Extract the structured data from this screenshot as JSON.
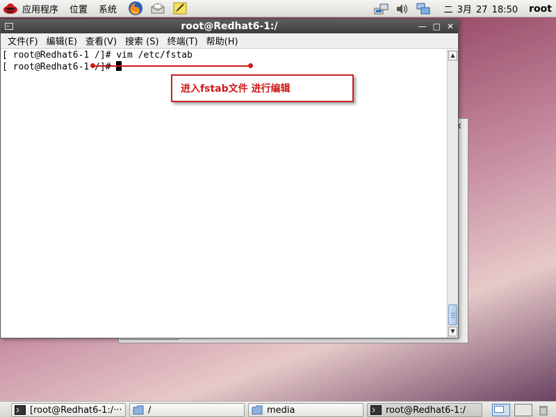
{
  "top_panel": {
    "menus": [
      {
        "name": "applications",
        "label": "应用程序"
      },
      {
        "name": "places",
        "label": "位置"
      },
      {
        "name": "system",
        "label": "系统"
      }
    ],
    "launchers": [
      "firefox-icon",
      "mail-icon",
      "notes-icon"
    ],
    "tray_icons": [
      "network-icon",
      "volume-icon",
      "display-icon"
    ],
    "clock": "二 3月 27 18:50",
    "user": "root"
  },
  "terminal": {
    "title": "root@Redhat6-1:/",
    "menu": [
      {
        "name": "file",
        "label": "文件(F)"
      },
      {
        "name": "edit",
        "label": "编辑(E)"
      },
      {
        "name": "view",
        "label": "查看(V)"
      },
      {
        "name": "search",
        "label": "搜索 (S)"
      },
      {
        "name": "terminal",
        "label": "终端(T)"
      },
      {
        "name": "help",
        "label": "帮助(H)"
      }
    ],
    "lines": [
      "[ root@Redhat6-1 /]# vim /etc/fstab",
      "[ root@Redhat6-1 /]# "
    ]
  },
  "annotation": {
    "text": "进入fstab文件  进行编辑",
    "color": "#d01818"
  },
  "taskbar": {
    "items": [
      {
        "name": "terminal",
        "label": "[root@Redhat6-1:/···"
      },
      {
        "name": "folder-root",
        "label": "/"
      },
      {
        "name": "folder-media",
        "label": "media"
      },
      {
        "name": "terminal-active",
        "label": "root@Redhat6-1:/"
      }
    ]
  }
}
